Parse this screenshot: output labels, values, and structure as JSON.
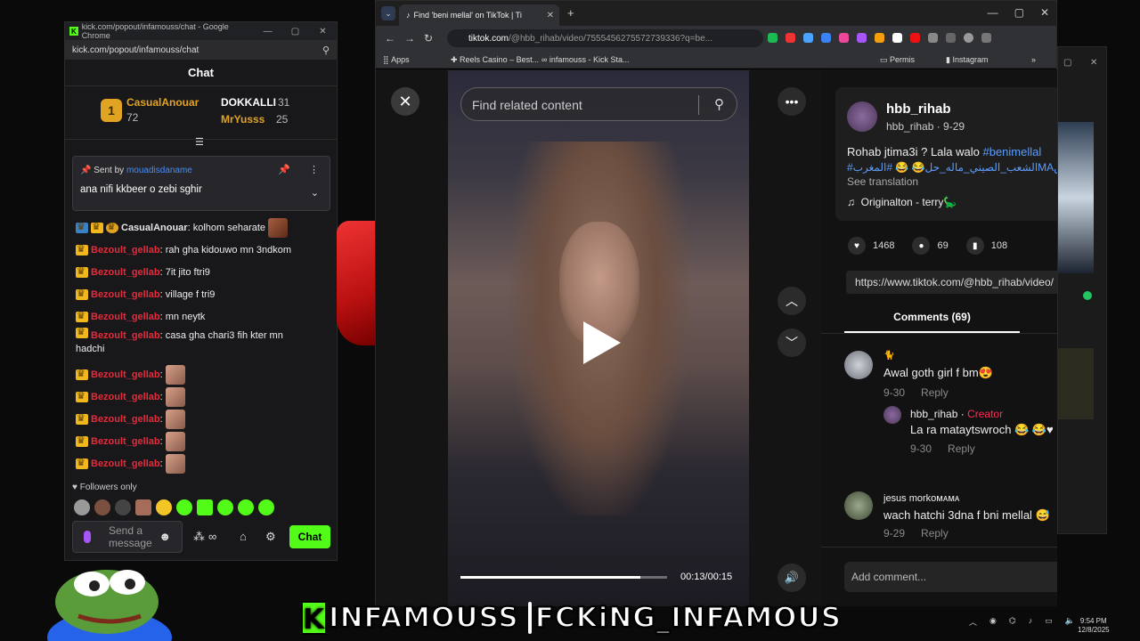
{
  "kick": {
    "window_title": "kick.com/popout/infamouss/chat - Google Chrome",
    "url": "kick.com/popout/infamouss/chat",
    "header": "Chat",
    "leaderboard": [
      {
        "rank": "1",
        "name": "CasualAnouar",
        "value": "72"
      },
      {
        "name": "DOKKALLI",
        "value": "31"
      },
      {
        "name": "MrYusss",
        "value": "25"
      }
    ],
    "pinned": {
      "sent_by_label": "Sent by",
      "sender": "mouadisdaname",
      "message": "ana nifi kkbeer o zebi sghir"
    },
    "messages": [
      {
        "user": "CasualAnouar",
        "text": "kolhom seharate",
        "color": "#e5e5e5"
      },
      {
        "user": "Bezoult_gellab",
        "text": "rah gha kidouwo mn 3ndkom",
        "color": "#e62b3b"
      },
      {
        "user": "Bezoult_gellab",
        "text": "7it jito ftri9",
        "color": "#e62b3b"
      },
      {
        "user": "Bezoult_gellab",
        "text": "village f tri9",
        "color": "#e62b3b"
      },
      {
        "user": "Bezoult_gellab",
        "text": "mn neytk",
        "color": "#e62b3b"
      },
      {
        "user": "Bezoult_gellab",
        "text": "casa gha chari3 fih kter mn",
        "text2": "hadchi",
        "color": "#e62b3b"
      },
      {
        "user": "Bezoult_gellab",
        "text": "",
        "color": "#e62b3b"
      },
      {
        "user": "Bezoult_gellab",
        "text": "",
        "color": "#e62b3b"
      },
      {
        "user": "Bezoult_gellab",
        "text": "",
        "color": "#e62b3b"
      },
      {
        "user": "Bezoult_gellab",
        "text": "",
        "color": "#e62b3b"
      },
      {
        "user": "Bezoult_gellab",
        "text": "",
        "color": "#e62b3b"
      }
    ],
    "followers_only": "Followers only",
    "send_placeholder": "Send a message",
    "chat_button": "Chat"
  },
  "tiktok": {
    "tab_title": "Find 'beni mellal' on TikTok | Ti",
    "url_host": "tiktok.com",
    "url_rest": "/@hbb_rihab/video/7555456275572739336?q=be...",
    "bookmarks": [
      "Apps",
      "Reels Casino – Best...",
      "infamouss - Kick Sta...",
      "Permis",
      "Instagram"
    ],
    "find_placeholder": "Find related content",
    "time": "00:13/00:15",
    "progress": 0.87,
    "author": "hbb_rihab",
    "author_sub": "hbb_rihab · 9-29",
    "caption": "Rohab jtima3i ? Lala walo ",
    "caption_tag": "#benimellal",
    "caption_line2": "#الشعب_الصيني_ماله_حل😂 😂 #المغربMAونس",
    "see_translation": "See translation",
    "music": "Originalton - terry🦕",
    "likes": "1468",
    "comments_count": "69",
    "saves": "108",
    "share_url": "https://www.tiktok.com/@hbb_rihab/video/",
    "comments_tab": "Comments (69)",
    "comments": [
      {
        "user": "🐈",
        "text": "Awal goth girl f bm😍",
        "date": "9-30",
        "reply": "Reply"
      },
      {
        "user": "hbb_rihab",
        "badge": "Creator",
        "text": "La ra mataytswroch 😂 😂♥",
        "date": "9-30",
        "reply": "Reply"
      },
      {
        "user": "jesus morkoᴍᴀᴍᴀ",
        "text": "wach hatchi 3dna f bni mellal 😅",
        "date": "9-29",
        "reply": "Reply"
      }
    ],
    "add_comment": "Add comment..."
  },
  "banner": {
    "left": "INFAMOUSS",
    "right": "FCKiNG_INFAMOUS"
  },
  "clock": {
    "time": "9:54 PM",
    "date": "12/8/2025"
  }
}
